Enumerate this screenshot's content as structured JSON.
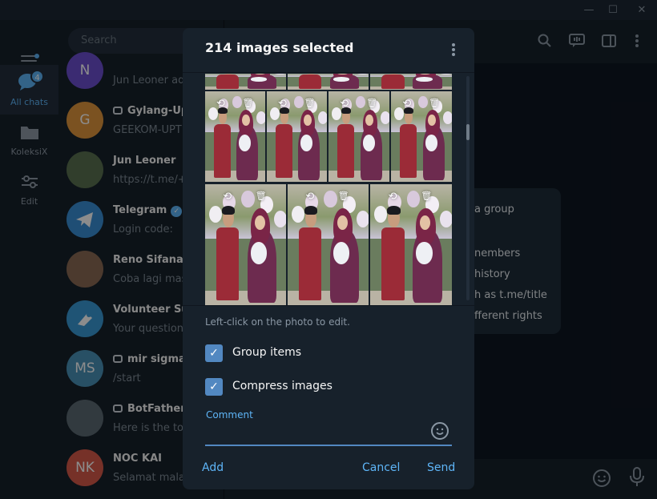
{
  "titlebar": {
    "minimize": "—",
    "maximize": "☐",
    "close": "✕"
  },
  "rail": {
    "items": [
      {
        "label": "All chats",
        "badge": "4"
      },
      {
        "label": "KoleksiX"
      },
      {
        "label": "Edit"
      }
    ]
  },
  "search": {
    "placeholder": "Search"
  },
  "chats": [
    {
      "name": "",
      "preview": "Jun Leoner adc",
      "initial": "N",
      "color": "#6c4fd0"
    },
    {
      "name": "Gylang-Upt",
      "preview": "GEEKOM-UPTI",
      "initial": "G",
      "color": "#e0963c",
      "bot": true
    },
    {
      "name": "Jun Leoner",
      "preview": "https://t.me/+l",
      "initial": "",
      "color": "#5a7250"
    },
    {
      "name": "Telegram",
      "preview": "Login code: ",
      "initial": "",
      "color": "#3a8fd6",
      "verified": true
    },
    {
      "name": "Reno Sifana Pa",
      "preview": "Coba lagi mas",
      "initial": "",
      "color": "#8a6b55"
    },
    {
      "name": "Volunteer Sup",
      "preview": "Your question",
      "initial": "",
      "color": "#3a9ad6"
    },
    {
      "name": "mir sigma",
      "preview": "/start",
      "initial": "MS",
      "color": "#4a93b8",
      "bot": true
    },
    {
      "name": "BotFather",
      "preview": "Here is the tok",
      "initial": "",
      "color": "#5c6a73",
      "bot": true
    },
    {
      "name": "NOC KAI",
      "preview": "Selamat malan",
      "initial": "NK",
      "color": "#d75a4a"
    }
  ],
  "info_lines": [
    "a group",
    "nembers",
    "history",
    "h as t.me/title",
    "fferent rights"
  ],
  "modal": {
    "title": "214 images selected",
    "hint": "Left-click on the photo to edit.",
    "group_items": "Group items",
    "compress_images": "Compress images",
    "comment_label": "Comment",
    "comment_value": "",
    "add": "Add",
    "cancel": "Cancel",
    "send": "Send"
  }
}
